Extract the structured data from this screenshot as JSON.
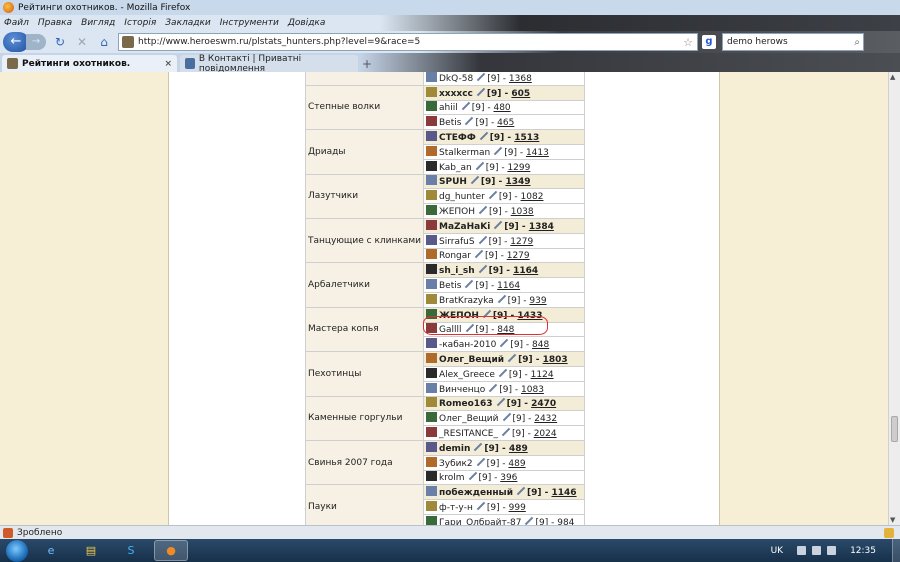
{
  "window": {
    "title": "Рейтинги охотников. - Mozilla Firefox"
  },
  "menu": [
    "Файл",
    "Правка",
    "Вигляд",
    "Історія",
    "Закладки",
    "Інструменти",
    "Довідка"
  ],
  "nav": {
    "url": "http://www.heroeswm.ru/plstats_hunters.php?level=9&race=5",
    "search_value": "demo herows"
  },
  "tabs": [
    {
      "label": "Рейтинги охотников.",
      "active": true
    },
    {
      "label": "В Контакті | Приватні повідомлення",
      "active": false
    }
  ],
  "table": {
    "groups": [
      {
        "faction": "",
        "players": [
          {
            "name": "DkQ-58",
            "level": "[9]",
            "points": "1368",
            "top": false
          }
        ]
      },
      {
        "faction": "Степные волки",
        "players": [
          {
            "name": "xxxxcc",
            "level": "[9]",
            "points": "605",
            "top": true
          },
          {
            "name": "ahiil",
            "level": "[9]",
            "points": "480",
            "top": false
          },
          {
            "name": "Betis",
            "level": "[9]",
            "points": "465",
            "top": false
          }
        ]
      },
      {
        "faction": "Дриады",
        "players": [
          {
            "name": "СТЕФФ",
            "level": "[9]",
            "points": "1513",
            "top": true
          },
          {
            "name": "Stalkerman",
            "level": "[9]",
            "points": "1413",
            "top": false
          },
          {
            "name": "Kab_an",
            "level": "[9]",
            "points": "1299",
            "top": false
          }
        ]
      },
      {
        "faction": "Лазутчики",
        "players": [
          {
            "name": "SPUH",
            "level": "[9]",
            "points": "1349",
            "top": true
          },
          {
            "name": "dg_hunter",
            "level": "[9]",
            "points": "1082",
            "top": false
          },
          {
            "name": "ЖЕПОН",
            "level": "[9]",
            "points": "1038",
            "top": false
          }
        ]
      },
      {
        "faction": "Танцующие с клинками",
        "players": [
          {
            "name": "MaZaHaKi",
            "level": "[9]",
            "points": "1384",
            "top": true
          },
          {
            "name": "SirrafuS",
            "level": "[9]",
            "points": "1279",
            "top": false
          },
          {
            "name": "Rongar",
            "level": "[9]",
            "points": "1279",
            "top": false
          }
        ]
      },
      {
        "faction": "Арбалетчики",
        "players": [
          {
            "name": "sh_i_sh",
            "level": "[9]",
            "points": "1164",
            "top": true
          },
          {
            "name": "Betis",
            "level": "[9]",
            "points": "1164",
            "top": false
          },
          {
            "name": "BratKrazyka",
            "level": "[9]",
            "points": "939",
            "top": false
          }
        ]
      },
      {
        "faction": "Мастера копья",
        "players": [
          {
            "name": "ЖЕПОН",
            "level": "[9]",
            "points": "1433",
            "top": true
          },
          {
            "name": "Gallll",
            "level": "[9]",
            "points": "848",
            "top": false
          },
          {
            "name": "-кабан-2010",
            "level": "[9]",
            "points": "848",
            "top": false
          }
        ]
      },
      {
        "faction": "Пехотинцы",
        "players": [
          {
            "name": "Олег_Вещий",
            "level": "[9]",
            "points": "1803",
            "top": true
          },
          {
            "name": "Alex_Greece",
            "level": "[9]",
            "points": "1124",
            "top": false
          },
          {
            "name": "Винченцо",
            "level": "[9]",
            "points": "1083",
            "top": false
          }
        ]
      },
      {
        "faction": "Каменные горгульи",
        "players": [
          {
            "name": "Romeo163",
            "level": "[9]",
            "points": "2470",
            "top": true
          },
          {
            "name": "Олег_Вещий",
            "level": "[9]",
            "points": "2432",
            "top": false
          },
          {
            "name": "_RESITANCE_",
            "level": "[9]",
            "points": "2024",
            "top": false
          }
        ]
      },
      {
        "faction": "Свинья 2007 года",
        "players": [
          {
            "name": "demin",
            "level": "[9]",
            "points": "489",
            "top": true
          },
          {
            "name": "Зубик2",
            "level": "[9]",
            "points": "489",
            "top": false
          },
          {
            "name": "krolm",
            "level": "[9]",
            "points": "396",
            "top": false
          }
        ]
      },
      {
        "faction": "Пауки",
        "players": [
          {
            "name": "побежденный",
            "level": "[9]",
            "points": "1146",
            "top": true
          },
          {
            "name": "ф-т-у-н",
            "level": "[9]",
            "points": "999",
            "top": false
          },
          {
            "name": "Гари_Олбрайт-87",
            "level": "[9]",
            "points": "984",
            "top": false
          }
        ]
      }
    ]
  },
  "status": {
    "text": "Зроблено"
  },
  "taskbar": {
    "lang": "UK",
    "clock": "12:35"
  },
  "colors": {
    "highlight": "#e03030",
    "page_bg": "#f7eed6"
  }
}
